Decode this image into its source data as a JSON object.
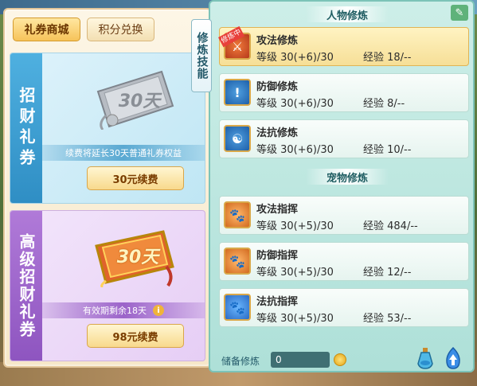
{
  "shop": {
    "tabs": [
      {
        "label": "礼券商城",
        "active": true
      },
      {
        "label": "积分兑换",
        "active": false
      }
    ],
    "cards": [
      {
        "side_label": "招财礼券",
        "ticket_text": "30天",
        "description": "续费将延长30天普通礼券权益",
        "button_label": "30元续费"
      },
      {
        "side_label": "高级招财礼券",
        "ticket_text": "30天",
        "description": "有效期剩余18天",
        "button_label": "98元续费"
      }
    ]
  },
  "training": {
    "side_tab_label": "修炼技能",
    "sections": [
      {
        "title": "人物修炼",
        "skills": [
          {
            "name": "攻法修炼",
            "level": "等级 30(+6)/30",
            "exp": "经验 18/--",
            "badge": "修炼中",
            "active": true,
            "icon": "attack-magic-icon"
          },
          {
            "name": "防御修炼",
            "level": "等级 30(+6)/30",
            "exp": "经验 8/--",
            "active": false,
            "icon": "defense-icon"
          },
          {
            "name": "法抗修炼",
            "level": "等级 30(+6)/30",
            "exp": "经验 10/--",
            "active": false,
            "icon": "magic-resist-icon"
          }
        ]
      },
      {
        "title": "宠物修炼",
        "skills": [
          {
            "name": "攻法指挥",
            "level": "等级 30(+5)/30",
            "exp": "经验 484/--",
            "active": false,
            "icon": "pet-attack-icon"
          },
          {
            "name": "防御指挥",
            "level": "等级 30(+5)/30",
            "exp": "经验 12/--",
            "active": false,
            "icon": "pet-defense-icon"
          },
          {
            "name": "法抗指挥",
            "level": "等级 30(+5)/30",
            "exp": "经验 53/--",
            "active": false,
            "icon": "pet-resist-icon"
          }
        ]
      }
    ],
    "reserve": {
      "label": "储备修炼",
      "value": "0"
    }
  }
}
